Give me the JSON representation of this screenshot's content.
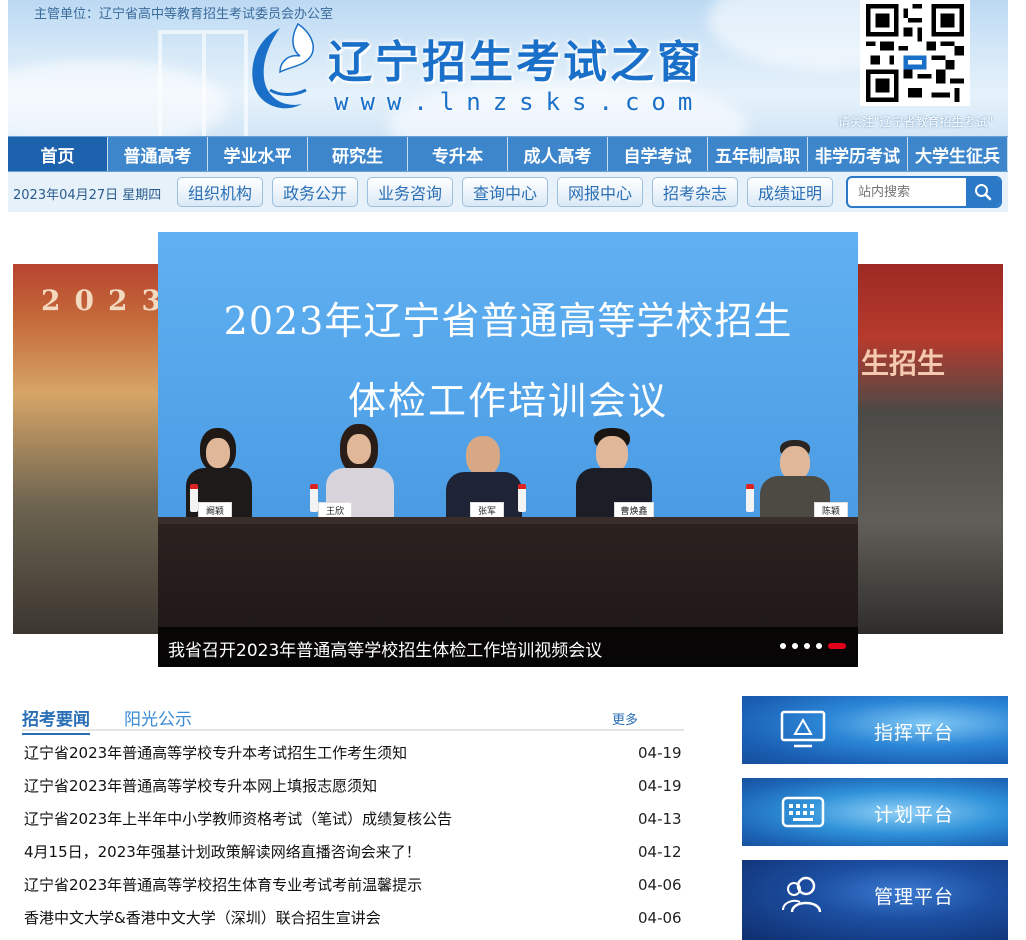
{
  "header": {
    "sponsor": "主管单位：辽宁省高中等教育招生考试委员会办公室",
    "title": "辽宁招生考试之窗",
    "domain": "www.lnzsks.com",
    "qr_note": "请关注\"辽宁省教育招生考试\""
  },
  "main_nav": [
    {
      "label": "首页",
      "active": true
    },
    {
      "label": "普通高考"
    },
    {
      "label": "学业水平"
    },
    {
      "label": "研究生"
    },
    {
      "label": "专升本"
    },
    {
      "label": "成人高考"
    },
    {
      "label": "自学考试"
    },
    {
      "label": "五年制高职"
    },
    {
      "label": "非学历考试"
    },
    {
      "label": "大学生征兵"
    }
  ],
  "sub_nav": {
    "date": "2023年04月27日 星期四",
    "items": [
      "组织机构",
      "政务公开",
      "业务咨询",
      "查询中心",
      "网报中心",
      "招考杂志",
      "成绩证明"
    ],
    "search_placeholder": "站内搜索"
  },
  "carousel": {
    "banner_line1": "2023年辽宁省普通高等学校招生",
    "banner_line2": "体检工作培训会议",
    "left_photo_text": "2023",
    "right_photo_text": "生招生",
    "nameplates": [
      "阚颖",
      "王欣",
      "张军",
      "曹焕鑫",
      "陈颖"
    ],
    "caption": "我省召开2023年普通高等学校招生体检工作培训视频会议",
    "dot_count": 5,
    "active_dot": 5
  },
  "news": {
    "tab_active": "招考要闻",
    "tab_other": "阳光公示",
    "more": "更多",
    "items": [
      {
        "title": "辽宁省2023年普通高等学校专升本考试招生工作考生须知",
        "date": "04-19"
      },
      {
        "title": "辽宁省2023年普通高等学校专升本网上填报志愿须知",
        "date": "04-19"
      },
      {
        "title": "辽宁省2023年上半年中小学教师资格考试（笔试）成绩复核公告",
        "date": "04-13"
      },
      {
        "title": "4月15日，2023年强基计划政策解读网络直播咨询会来了！",
        "date": "04-12"
      },
      {
        "title": "辽宁省2023年普通高等学校招生体育专业考试考前温馨提示",
        "date": "04-06"
      },
      {
        "title": "香港中文大学&香港中文大学（深圳）联合招生宣讲会",
        "date": "04-06"
      }
    ]
  },
  "platforms": [
    {
      "label": "指挥平台",
      "icon": "monitor-icon"
    },
    {
      "label": "计划平台",
      "icon": "keyboard-icon"
    },
    {
      "label": "管理平台",
      "icon": "users-icon"
    }
  ]
}
